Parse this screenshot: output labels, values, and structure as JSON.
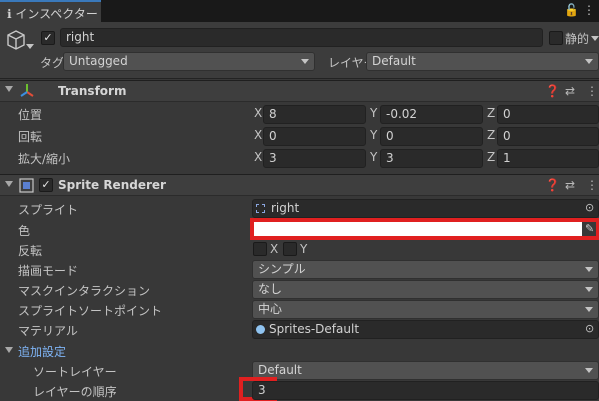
{
  "tab": {
    "title": "インスペクター"
  },
  "object": {
    "name": "right",
    "static_label": "静的",
    "tag_label": "タグ",
    "tag_value": "Untagged",
    "layer_label": "レイヤー",
    "layer_value": "Default"
  },
  "transform": {
    "title": "Transform",
    "rows": [
      {
        "label": "位置",
        "x": "8",
        "y": "-0.02",
        "z": "0"
      },
      {
        "label": "回転",
        "x": "0",
        "y": "0",
        "z": "0"
      },
      {
        "label": "拡大/縮小",
        "x": "3",
        "y": "3",
        "z": "1"
      }
    ],
    "axes": {
      "x": "X",
      "y": "Y",
      "z": "Z"
    }
  },
  "sprite_renderer": {
    "title": "Sprite Renderer",
    "sprite_label": "スプライト",
    "sprite_value": "right",
    "color_label": "色",
    "color_value": "#ffffff",
    "flip_label": "反転",
    "flip_x": "X",
    "flip_y": "Y",
    "draw_mode_label": "描画モード",
    "draw_mode_value": "シンプル",
    "mask_label": "マスクインタラクション",
    "mask_value": "なし",
    "sort_point_label": "スプライトソートポイント",
    "sort_point_value": "中心",
    "material_label": "マテリアル",
    "material_value": "Sprites-Default",
    "additional_label": "追加設定",
    "sorting_layer_label": "ソートレイヤー",
    "sorting_layer_value": "Default",
    "order_label": "レイヤーの順序",
    "order_value": "3"
  }
}
